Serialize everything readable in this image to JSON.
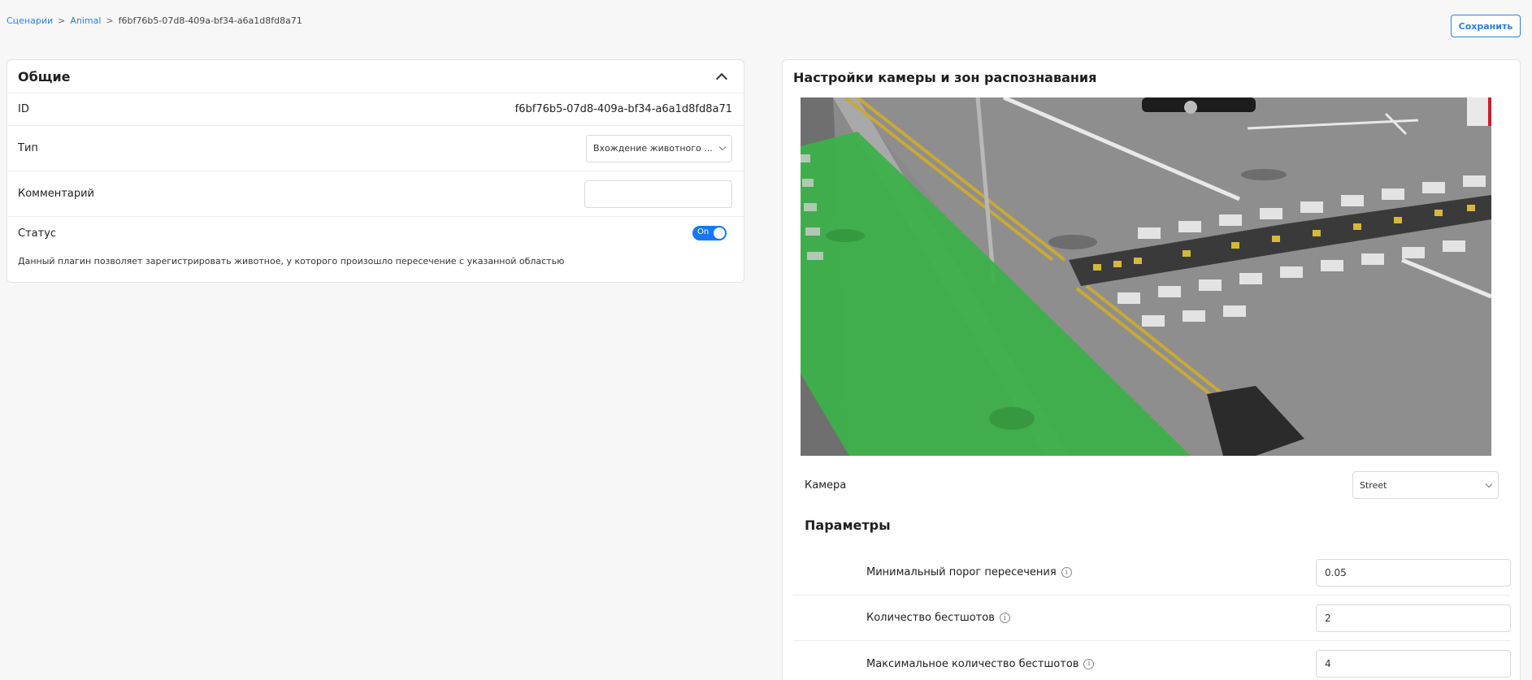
{
  "breadcrumb": {
    "items": [
      "Сценарии",
      "Animal"
    ],
    "current": "f6bf76b5-07d8-409a-bf34-a6a1d8fd8a71",
    "separator": ">"
  },
  "toolbar": {
    "save_label": "Сохранить"
  },
  "general": {
    "title": "Общие",
    "id_label": "ID",
    "id_value": "f6bf76b5-07d8-409a-bf34-a6a1d8fd8a71",
    "type_label": "Тип",
    "type_value": "Вхождение животного ...",
    "comment_label": "Комментарий",
    "comment_value": "",
    "status_label": "Статус",
    "status_toggle": "On",
    "description": "Данный плагин позволяет зарегистрировать животное, у которого произошло пересечение с указанной областью"
  },
  "camera": {
    "title": "Настройки камеры и зон распознавания",
    "camera_label": "Камера",
    "camera_value": "Street",
    "zone_color": "#3db04a"
  },
  "params": {
    "title": "Параметры",
    "items": [
      {
        "label": "Минимальный порог пересечения",
        "value": "0.05"
      },
      {
        "label": "Количество бестшотов",
        "value": "2"
      },
      {
        "label": "Максимальное количество бестшотов",
        "value": "4"
      }
    ]
  },
  "accent_color": "#1677ff"
}
